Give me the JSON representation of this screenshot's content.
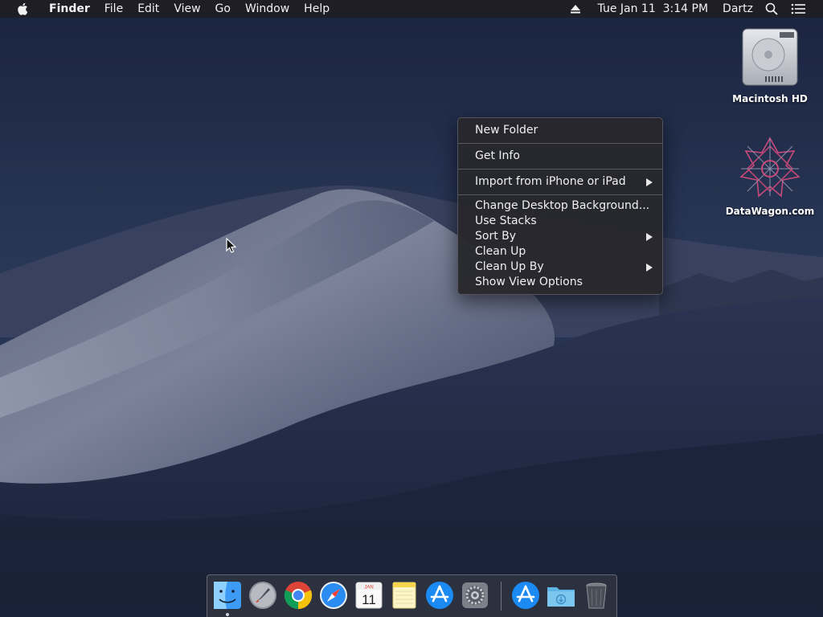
{
  "menubar": {
    "app_name": "Finder",
    "menus": [
      "File",
      "Edit",
      "View",
      "Go",
      "Window",
      "Help"
    ],
    "datetime": "Tue Jan 11  3:14 PM",
    "user": "Dartz"
  },
  "desktop_icons": [
    {
      "label": "Macintosh HD",
      "icon": "hard-drive-icon"
    },
    {
      "label": "DataWagon.com",
      "icon": "datawagon-logo-icon"
    }
  ],
  "context_menu": {
    "items": [
      {
        "label": "New Folder",
        "submenu": false
      },
      {
        "label": "Get Info",
        "submenu": false
      },
      {
        "label": "Import from iPhone or iPad",
        "submenu": true
      },
      {
        "label": "Change Desktop Background...",
        "submenu": false
      },
      {
        "label": "Use Stacks",
        "submenu": false
      },
      {
        "label": "Sort By",
        "submenu": true
      },
      {
        "label": "Clean Up",
        "submenu": false
      },
      {
        "label": "Clean Up By",
        "submenu": true
      },
      {
        "label": "Show View Options",
        "submenu": false
      }
    ]
  },
  "dock": {
    "apps": [
      {
        "name": "Finder",
        "icon": "finder-icon",
        "running": true
      },
      {
        "name": "Launchpad",
        "icon": "launchpad-icon",
        "running": false
      },
      {
        "name": "Google Chrome",
        "icon": "chrome-icon",
        "running": false
      },
      {
        "name": "Safari",
        "icon": "safari-icon",
        "running": false
      },
      {
        "name": "Calendar",
        "icon": "calendar-icon",
        "running": false,
        "calendar_month": "JAN",
        "calendar_day": "11"
      },
      {
        "name": "Notes",
        "icon": "notes-icon",
        "running": false
      },
      {
        "name": "App Store",
        "icon": "app-store-icon",
        "running": false
      },
      {
        "name": "System Preferences",
        "icon": "system-preferences-icon",
        "running": false
      },
      {
        "name": "App Store (downloads)",
        "icon": "app-store-icon",
        "running": false
      },
      {
        "name": "Downloads",
        "icon": "downloads-folder-icon",
        "running": false
      },
      {
        "name": "Trash",
        "icon": "trash-icon",
        "running": false
      }
    ]
  },
  "colors": {
    "menubar_bg": "#1e1e22",
    "menu_bg": "#28282c",
    "wallpaper_dark": "#18223a",
    "dune_light": "#8a90a6"
  }
}
